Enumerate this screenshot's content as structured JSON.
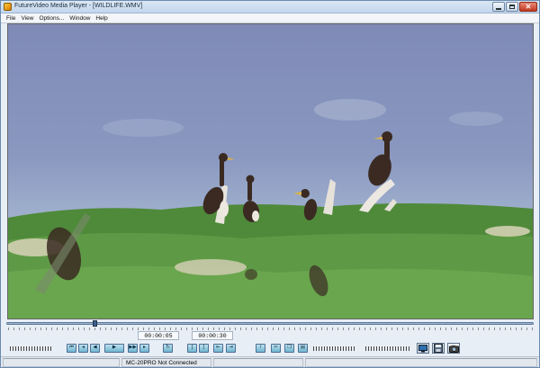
{
  "window": {
    "title": "FutureVideo Media Player - [WILDLIFE.WMV]"
  },
  "menu": {
    "items": [
      "File",
      "View",
      "Options...",
      "Window",
      "Help"
    ]
  },
  "player": {
    "position_fraction": 0.165
  },
  "timecodes": {
    "current": "00:00:05",
    "duration": "00:00:30"
  },
  "transport": {
    "group1": [
      "skip-to-start",
      "frame-back",
      "rewind",
      "stop",
      "play",
      "fast-forward",
      "frame-forward",
      "skip-to-end"
    ],
    "group2": [
      "loop"
    ],
    "group3": [
      "mark-in",
      "mark-out",
      "goto-in",
      "goto-out"
    ],
    "group4": [
      "edit",
      "cut",
      "copy",
      "paste"
    ],
    "icons": [
      "monitor-icon",
      "save-icon",
      "camera-icon"
    ]
  },
  "status": {
    "device": "MC-20PRO Not Connected"
  }
}
